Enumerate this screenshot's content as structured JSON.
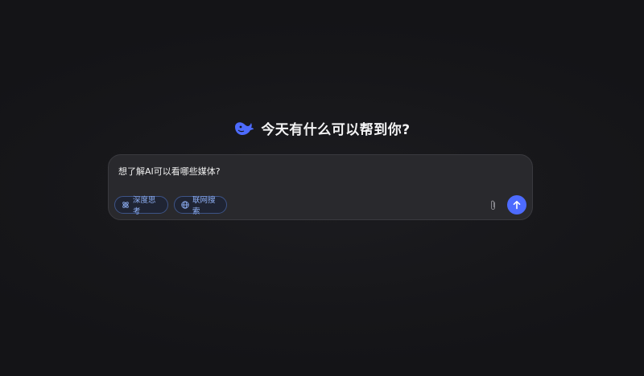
{
  "greeting": {
    "text": "今天有什么可以帮到你?"
  },
  "composer": {
    "input_value": "想了解AI可以看哪些媒体?",
    "chips": {
      "deep_think_label": "深度思考",
      "web_search_label": "联网搜索"
    },
    "icons": {
      "logo": "whale-logo-icon",
      "deep_think": "atom-icon",
      "web_search": "globe-icon",
      "attach": "paperclip-icon",
      "send": "arrow-up-icon"
    }
  },
  "colors": {
    "background": "#16161a",
    "composer_bg": "#29292d",
    "accent": "#4d6bfe",
    "chip_text": "#8fb0f5",
    "chip_border": "#3d5488"
  }
}
